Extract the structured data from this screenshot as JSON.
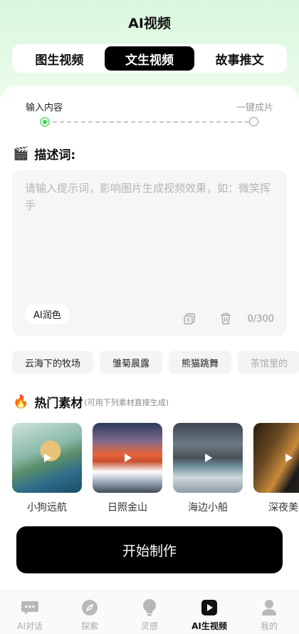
{
  "header": {
    "title": "AI视频"
  },
  "tabs": [
    {
      "label": "图生视频"
    },
    {
      "label": "文生视频"
    },
    {
      "label": "故事推文"
    }
  ],
  "steps": {
    "left": "输入内容",
    "right": "一键成片"
  },
  "describe": {
    "icon": "🎬",
    "title": "描述词:"
  },
  "prompt": {
    "placeholder": "请输入提示词，影响图片生成视频效果，如：微笑挥手",
    "polish_label": "AI润色",
    "counter": "0/300"
  },
  "chips": [
    "云海下的牧场",
    "雏菊晨露",
    "熊猫跳舞",
    "茶馆里的"
  ],
  "hot": {
    "icon": "🔥",
    "title": "热门素材",
    "subtitle": "(可用下列素材直接生成)"
  },
  "materials": [
    {
      "label": "小狗远航"
    },
    {
      "label": "日照金山"
    },
    {
      "label": "海边小船"
    },
    {
      "label": "深夜美女"
    }
  ],
  "start_button": "开始制作",
  "nav": [
    {
      "label": "AI对话",
      "icon": "chat-icon"
    },
    {
      "label": "探索",
      "icon": "compass-icon"
    },
    {
      "label": "灵感",
      "icon": "bulb-icon"
    },
    {
      "label": "AI生视频",
      "icon": "play-icon"
    },
    {
      "label": "我的",
      "icon": "user-icon"
    }
  ],
  "colors": {
    "accent": "#000000",
    "step_active": "#3fcf57"
  }
}
